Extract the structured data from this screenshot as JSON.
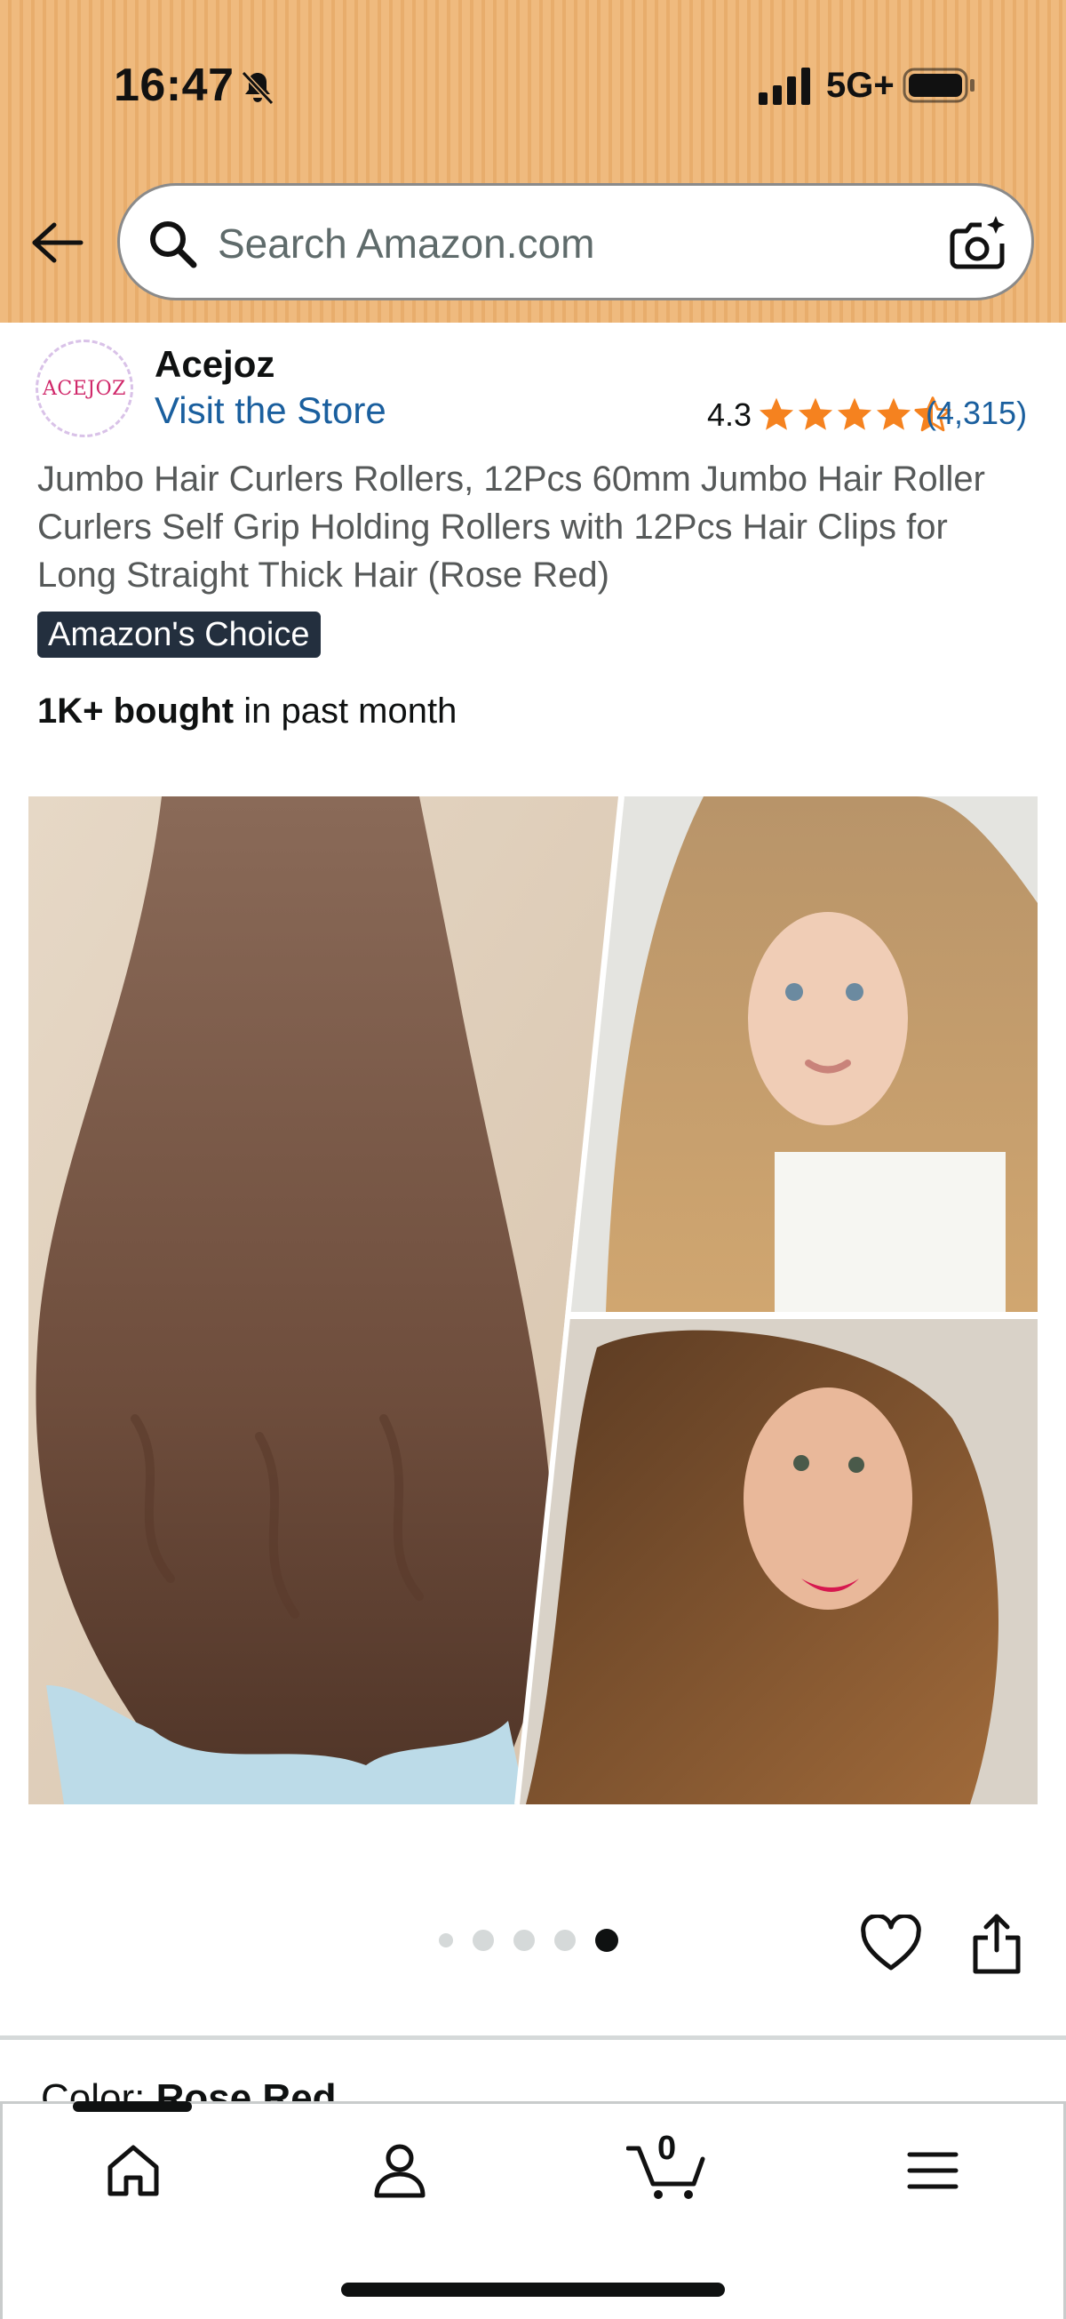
{
  "status_bar": {
    "time": "16:47",
    "network": "5G+",
    "icons": [
      "bell-slash-icon",
      "signal-bars-icon",
      "battery-icon"
    ]
  },
  "search": {
    "placeholder": "Search Amazon.com",
    "icons": [
      "back-arrow-icon",
      "search-icon",
      "camera-search-icon"
    ]
  },
  "brand": {
    "logo_text": "ACEJOZ",
    "name": "Acejoz",
    "store_link": "Visit the Store"
  },
  "rating": {
    "value": "4.3",
    "stars_filled": 4.3,
    "stars_total": 5,
    "review_count": "(4,315)"
  },
  "product": {
    "title": "Jumbo Hair Curlers Rollers, 12Pcs 60mm Jumbo Hair Roller Curlers Self Grip Holding Rollers with 12Pcs Hair Clips for Long Straight Thick Hair (Rose Red)",
    "badge": "Amazon's Choice",
    "bought_bold": "1K+ bought",
    "bought_rest": " in past month"
  },
  "carousel": {
    "total": 5,
    "active_index": 5
  },
  "variation": {
    "label": "Color: ",
    "value": "Rose Red"
  },
  "bottom_nav": {
    "items": [
      "home-icon",
      "account-icon",
      "cart-icon",
      "menu-icon"
    ],
    "cart_count": "0"
  },
  "colors": {
    "header_bg": "#efba7e",
    "link": "#1a5f9e",
    "star": "#f5821f",
    "badge_bg": "#232f3e"
  }
}
